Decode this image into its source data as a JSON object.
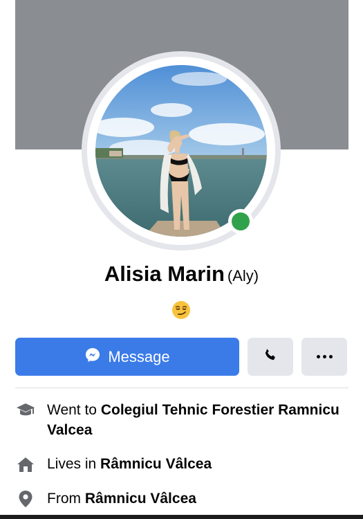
{
  "profile": {
    "name": "Alisia Marin",
    "nickname": "(Aly)",
    "status_emoji": "😏",
    "online": true
  },
  "actions": {
    "message_label": "Message",
    "call_icon": "phone-icon",
    "more_icon": "more-dots-icon"
  },
  "intro": {
    "education": {
      "prefix": "Went to",
      "value": "Colegiul Tehnic Forestier Ramnicu Valcea"
    },
    "lives": {
      "prefix": "Lives in",
      "value": "Râmnicu Vâlcea"
    },
    "from": {
      "prefix": "From",
      "value": "Râmnicu Vâlcea"
    }
  },
  "colors": {
    "cover": "#8a8d91",
    "primary": "#3b7be8",
    "secondary_button": "#e4e6eb",
    "online": "#31a24c"
  }
}
